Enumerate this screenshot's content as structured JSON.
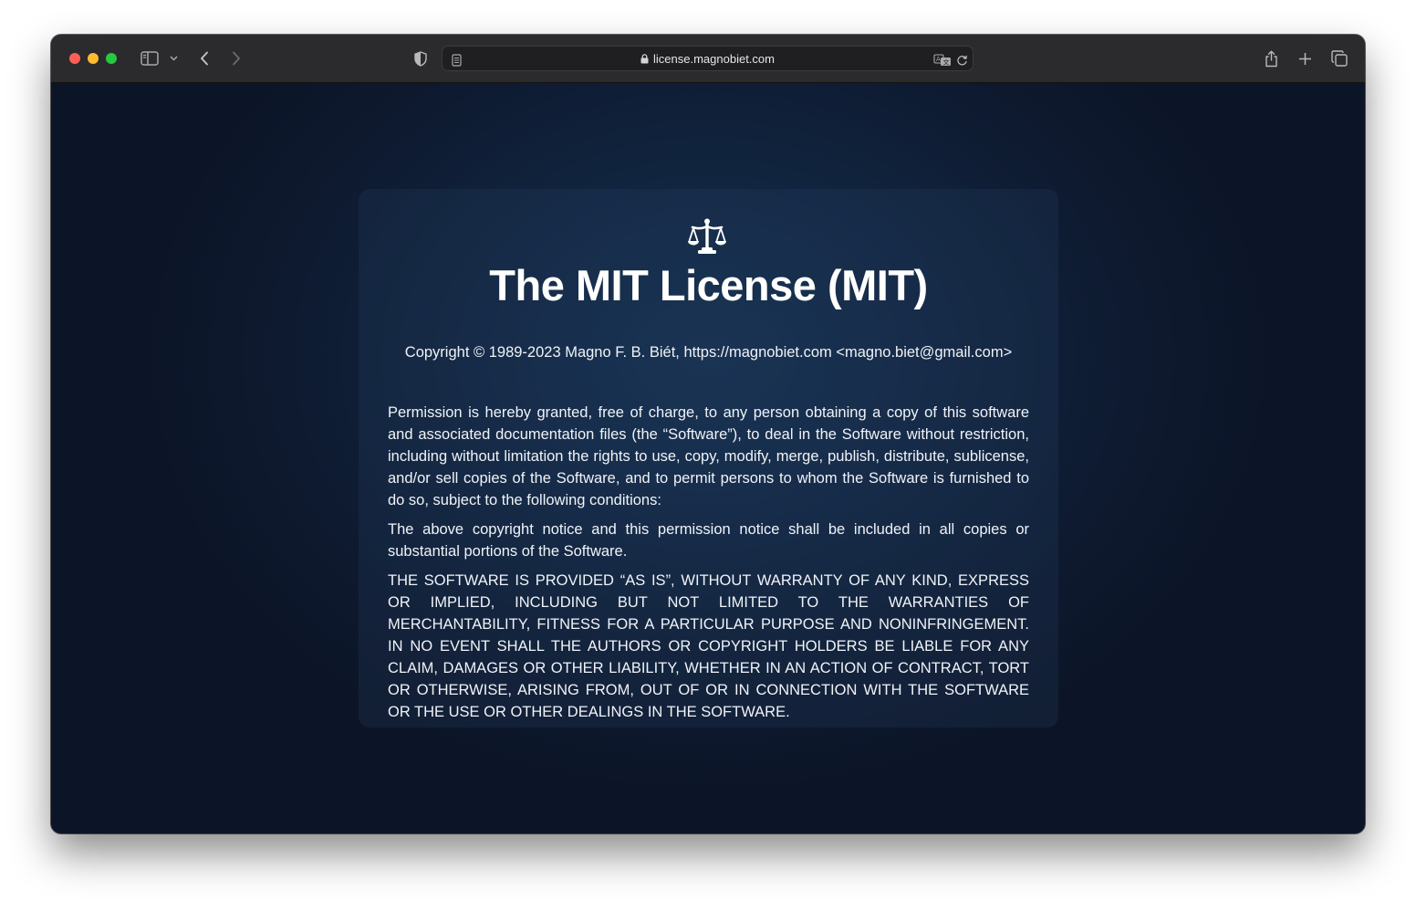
{
  "browser": {
    "url": "license.magnobiet.com",
    "icons": {
      "sidebar": "sidebar-icon",
      "sidebar_menu": "chevron-down-icon",
      "back": "chevron-left-icon",
      "forward": "chevron-right-icon",
      "privacy": "shield-icon",
      "reader": "reader-icon",
      "lock": "lock-icon",
      "translate": "translate-icon",
      "reload": "reload-icon",
      "share": "share-icon",
      "new_tab": "plus-icon",
      "tabs": "tabs-overview-icon"
    }
  },
  "page": {
    "logo_icon": "scales-icon",
    "title": "The MIT License (MIT)",
    "copyright": "Copyright © 1989-2023 Magno F. B. Biét, https://magnobiet.com <magno.biet@gmail.com>",
    "paragraphs": [
      "Permission is hereby granted, free of charge, to any person obtaining a copy of this software and associated documentation files (the “Software”), to deal in the Software without restriction, including without limitation the rights to use, copy, modify, merge, publish, distribute, sublicense, and/or sell copies of the Software, and to permit persons to whom the Software is furnished to do so, subject to the following conditions:",
      "The above copyright notice and this permission notice shall be included in all copies or substantial portions of the Software.",
      "THE SOFTWARE IS PROVIDED “AS IS”, WITHOUT WARRANTY OF ANY KIND, EXPRESS OR IMPLIED, INCLUDING BUT NOT LIMITED TO THE WARRANTIES OF MERCHANTABILITY, FITNESS FOR A PARTICULAR PURPOSE AND NONINFRINGEMENT. IN NO EVENT SHALL THE AUTHORS OR COPYRIGHT HOLDERS BE LIABLE FOR ANY CLAIM, DAMAGES OR OTHER LIABILITY, WHETHER IN AN ACTION OF CONTRACT, TORT OR OTHERWISE, ARISING FROM, OUT OF OR IN CONNECTION WITH THE SOFTWARE OR THE USE OR OTHER DEALINGS IN THE SOFTWARE."
    ]
  },
  "colors": {
    "page_background": "#0d1526",
    "toolbar": "#2b2b2d",
    "text": "#f0f3f7"
  }
}
